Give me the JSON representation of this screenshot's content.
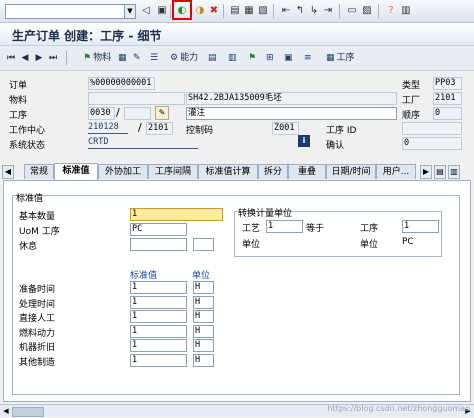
{
  "toolbar": {
    "command_value": "",
    "icons": [
      "enter-icon",
      "save-icon",
      "back-icon",
      "exit-icon",
      "cancel-icon",
      "print-icon",
      "find-icon",
      "find-next-icon",
      "first-page-icon",
      "prev-page-icon",
      "next-page-icon",
      "last-page-icon",
      "create-session-icon",
      "shortcut-icon",
      "help-icon"
    ]
  },
  "title": "生产订单 创建：工序 - 细节",
  "app_toolbar": {
    "material_label": "物料",
    "capacity_label": "能力",
    "operation_label": "工序"
  },
  "header": {
    "order_label": "订单",
    "order_value": "%00000000001",
    "type_label": "类型",
    "type_value": "PP03",
    "material_label": "物料",
    "material_value": "",
    "material_desc": "SH42.2BJA135009毛坯",
    "plant_label": "工厂",
    "plant_value": "2101",
    "operation_label": "工序",
    "operation_value": "0030",
    "operation_sub": "",
    "operation_desc": "灌注",
    "sequence_label": "顺序",
    "sequence_value": "0",
    "workcenter_label": "工作中心",
    "workcenter_value": "210128",
    "workcenter_plant": "2101",
    "control_key_label": "控制码",
    "control_key_value": "Z001",
    "work_id_label": "工序 ID",
    "work_id_value": "",
    "system_status_label": "系统状态",
    "system_status_value": "CRTD",
    "confirm_label": "确认",
    "confirm_value": "0"
  },
  "tabs": [
    "常规",
    "标准值",
    "外协加工",
    "工序间隔",
    "标准值计算",
    "拆分",
    "重叠",
    "日期/时间",
    "用户..."
  ],
  "active_tab": "标准值",
  "panel": {
    "group_title": "标准值",
    "base_qty_label": "基本数量",
    "base_qty_value": "1",
    "uom_label": "UoM 工序",
    "uom_value": "PC",
    "break_label": "休息",
    "break_value": "",
    "break_value2": "",
    "conv_title": "转换计量单位",
    "conv_op_label": "工艺",
    "conv_op_value": "1",
    "conv_eq_label": "等于",
    "conv_wo_label": "工序",
    "conv_wo_value": "1",
    "conv_unit_label": "单位",
    "conv_unit_value": "",
    "conv_unit2_label": "单位",
    "conv_unit2_value": "PC",
    "std_header": "标准值",
    "unit_header": "单位",
    "activities": [
      {
        "label": "准备时间",
        "value": "1",
        "unit": "H"
      },
      {
        "label": "处理时间",
        "value": "1",
        "unit": "H"
      },
      {
        "label": "直接人工",
        "value": "1",
        "unit": "H"
      },
      {
        "label": "燃料动力",
        "value": "1",
        "unit": "H"
      },
      {
        "label": "机器折旧",
        "value": "1",
        "unit": "H"
      },
      {
        "label": "其他制造",
        "value": "1",
        "unit": "H"
      }
    ]
  },
  "watermark": "https://blog.csdn.net/zhongguomao"
}
